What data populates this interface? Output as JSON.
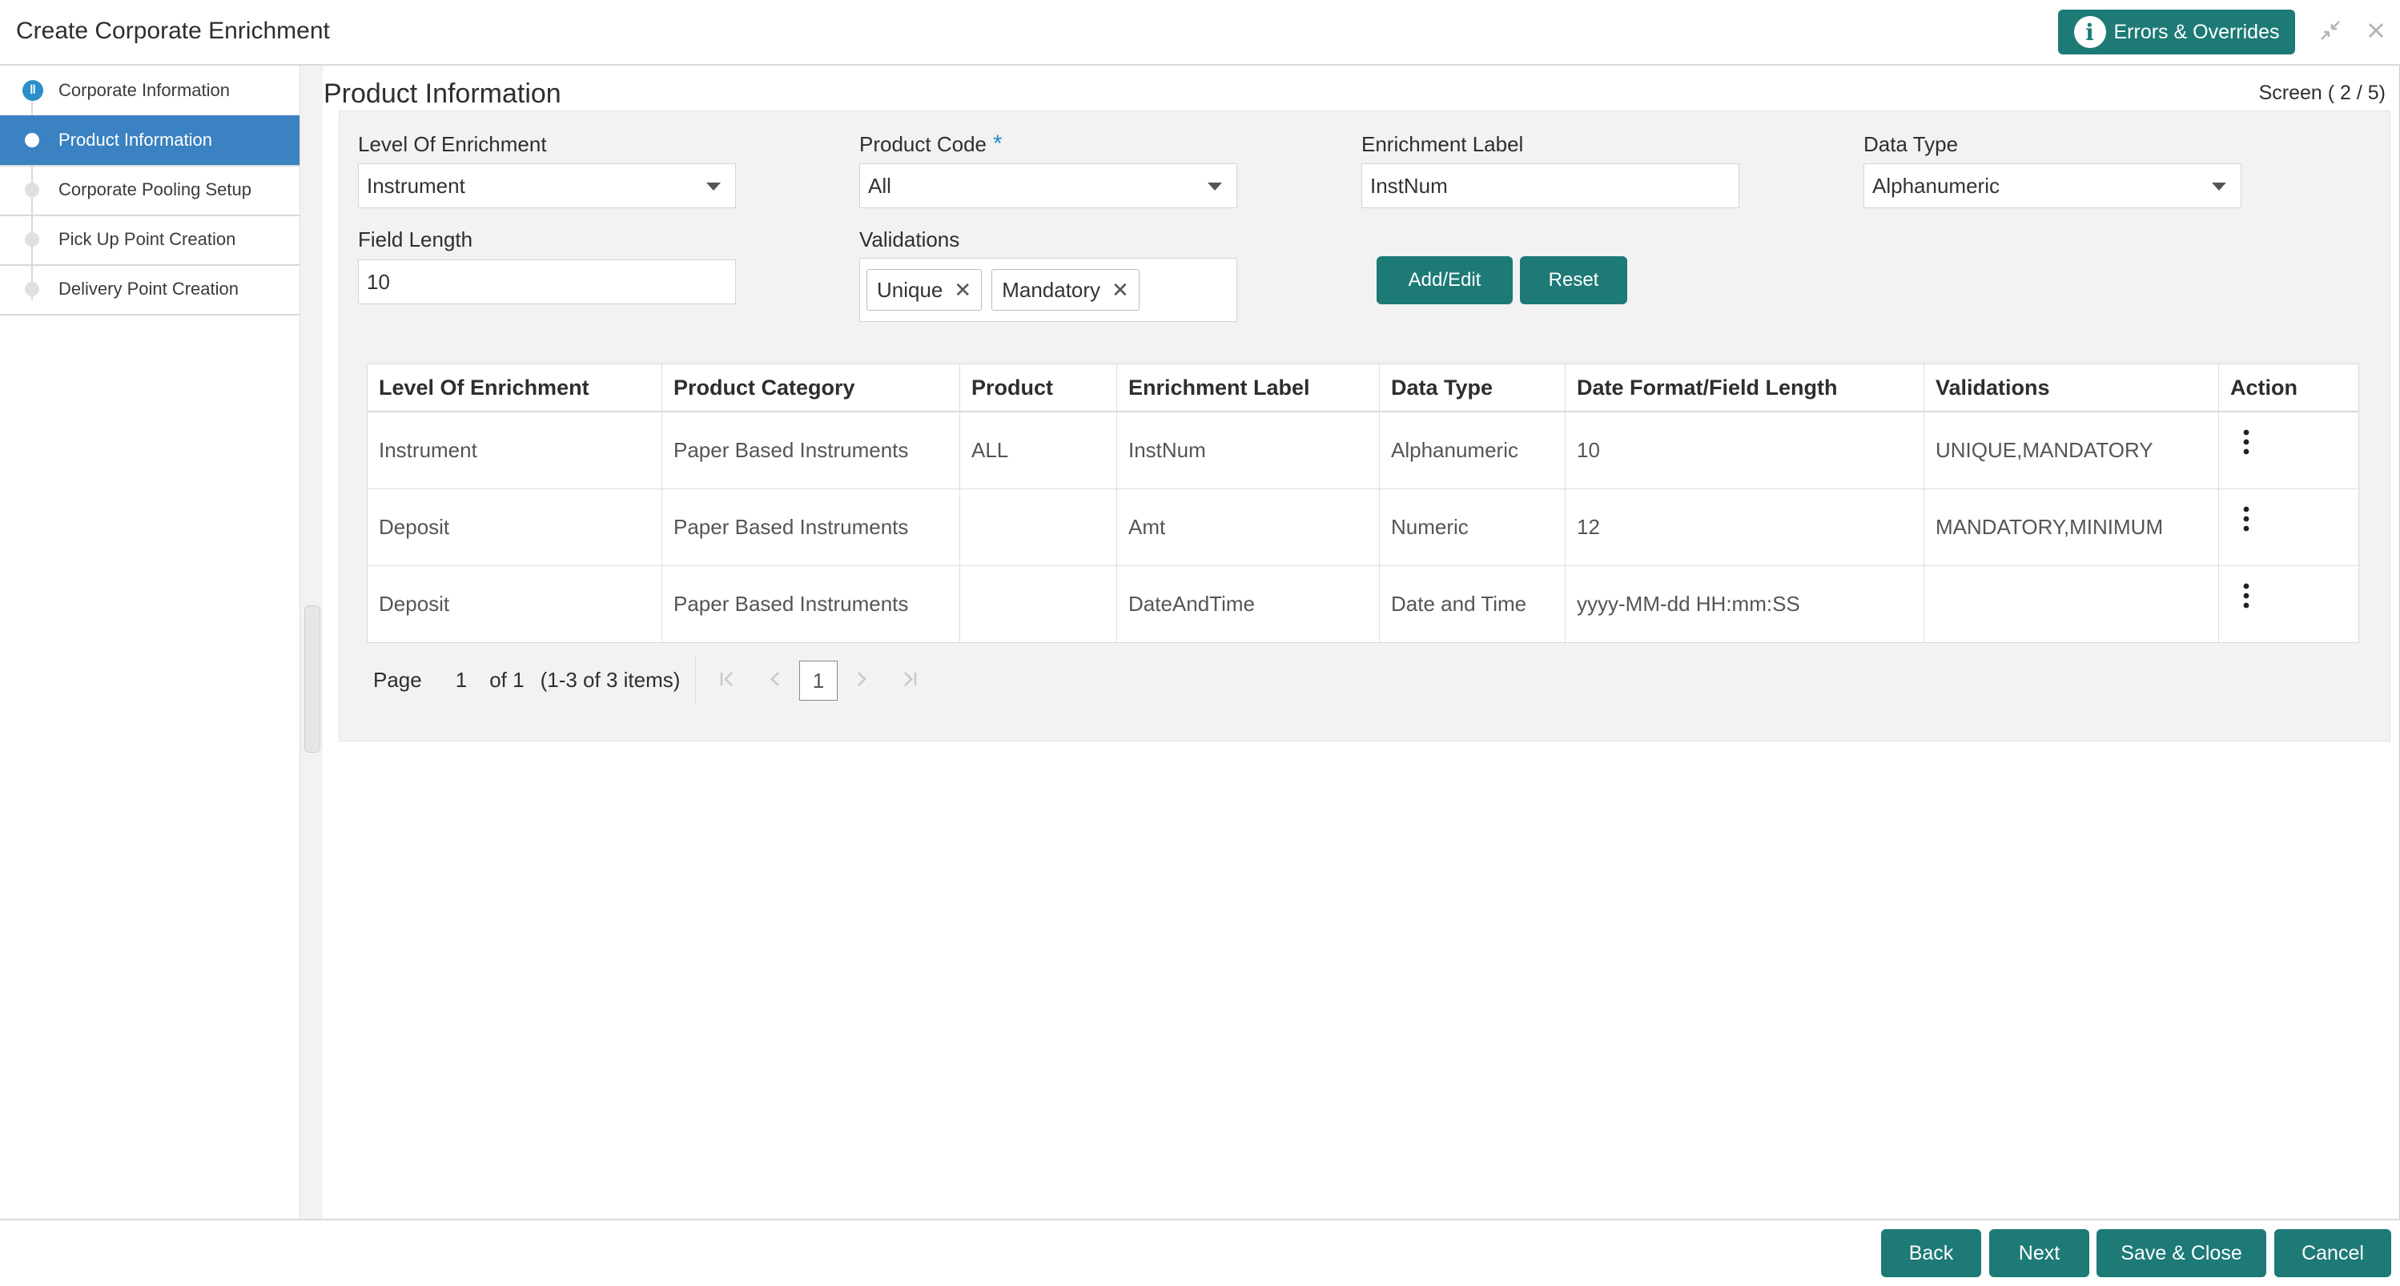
{
  "window": {
    "title": "Create Corporate Enrichment",
    "errors_label": "Errors & Overrides",
    "colors": {
      "accent": "#1d7a76",
      "active_step": "#3a82c1",
      "step_marker": "#2a8fc9"
    }
  },
  "sidebar": {
    "steps": [
      {
        "label": "Corporate Information",
        "state": "current"
      },
      {
        "label": "Product Information",
        "state": "active"
      },
      {
        "label": "Corporate Pooling Setup",
        "state": "pending"
      },
      {
        "label": "Pick Up Point Creation",
        "state": "pending"
      },
      {
        "label": "Delivery Point Creation",
        "state": "pending"
      }
    ]
  },
  "main": {
    "section_title": "Product Information",
    "screen_indicator": "Screen ( 2 / 5)",
    "form": {
      "level_of_enrichment": {
        "label": "Level Of Enrichment",
        "value": "Instrument"
      },
      "product_code": {
        "label": "Product Code",
        "required_mark": "*",
        "value": "All"
      },
      "enrichment_label": {
        "label": "Enrichment Label",
        "value": "InstNum"
      },
      "data_type": {
        "label": "Data Type",
        "value": "Alphanumeric"
      },
      "field_length": {
        "label": "Field Length",
        "value": "10"
      },
      "validations": {
        "label": "Validations",
        "tags": [
          "Unique",
          "Mandatory"
        ]
      },
      "add_edit_label": "Add/Edit",
      "reset_label": "Reset"
    },
    "table": {
      "columns": [
        "Level Of Enrichment",
        "Product Category",
        "Product",
        "Enrichment Label",
        "Data Type",
        "Date Format/Field Length",
        "Validations",
        "Action"
      ],
      "rows": [
        [
          "Instrument",
          "Paper Based Instruments",
          "ALL",
          "InstNum",
          "Alphanumeric",
          "10",
          "UNIQUE,MANDATORY"
        ],
        [
          "Deposit",
          "Paper Based Instruments",
          "",
          "Amt",
          "Numeric",
          "12",
          "MANDATORY,MINIMUM"
        ],
        [
          "Deposit",
          "Paper Based Instruments",
          "",
          "DateAndTime",
          "Date and Time",
          "yyyy-MM-dd HH:mm:SS",
          ""
        ]
      ]
    },
    "pagination": {
      "page_label": "Page",
      "page_value": "1",
      "of_label": "of 1",
      "items_label": "(1-3 of 3 items)",
      "current_page": "1"
    }
  },
  "footer": {
    "back_label": "Back",
    "next_label": "Next",
    "save_close_label": "Save & Close",
    "cancel_label": "Cancel"
  }
}
